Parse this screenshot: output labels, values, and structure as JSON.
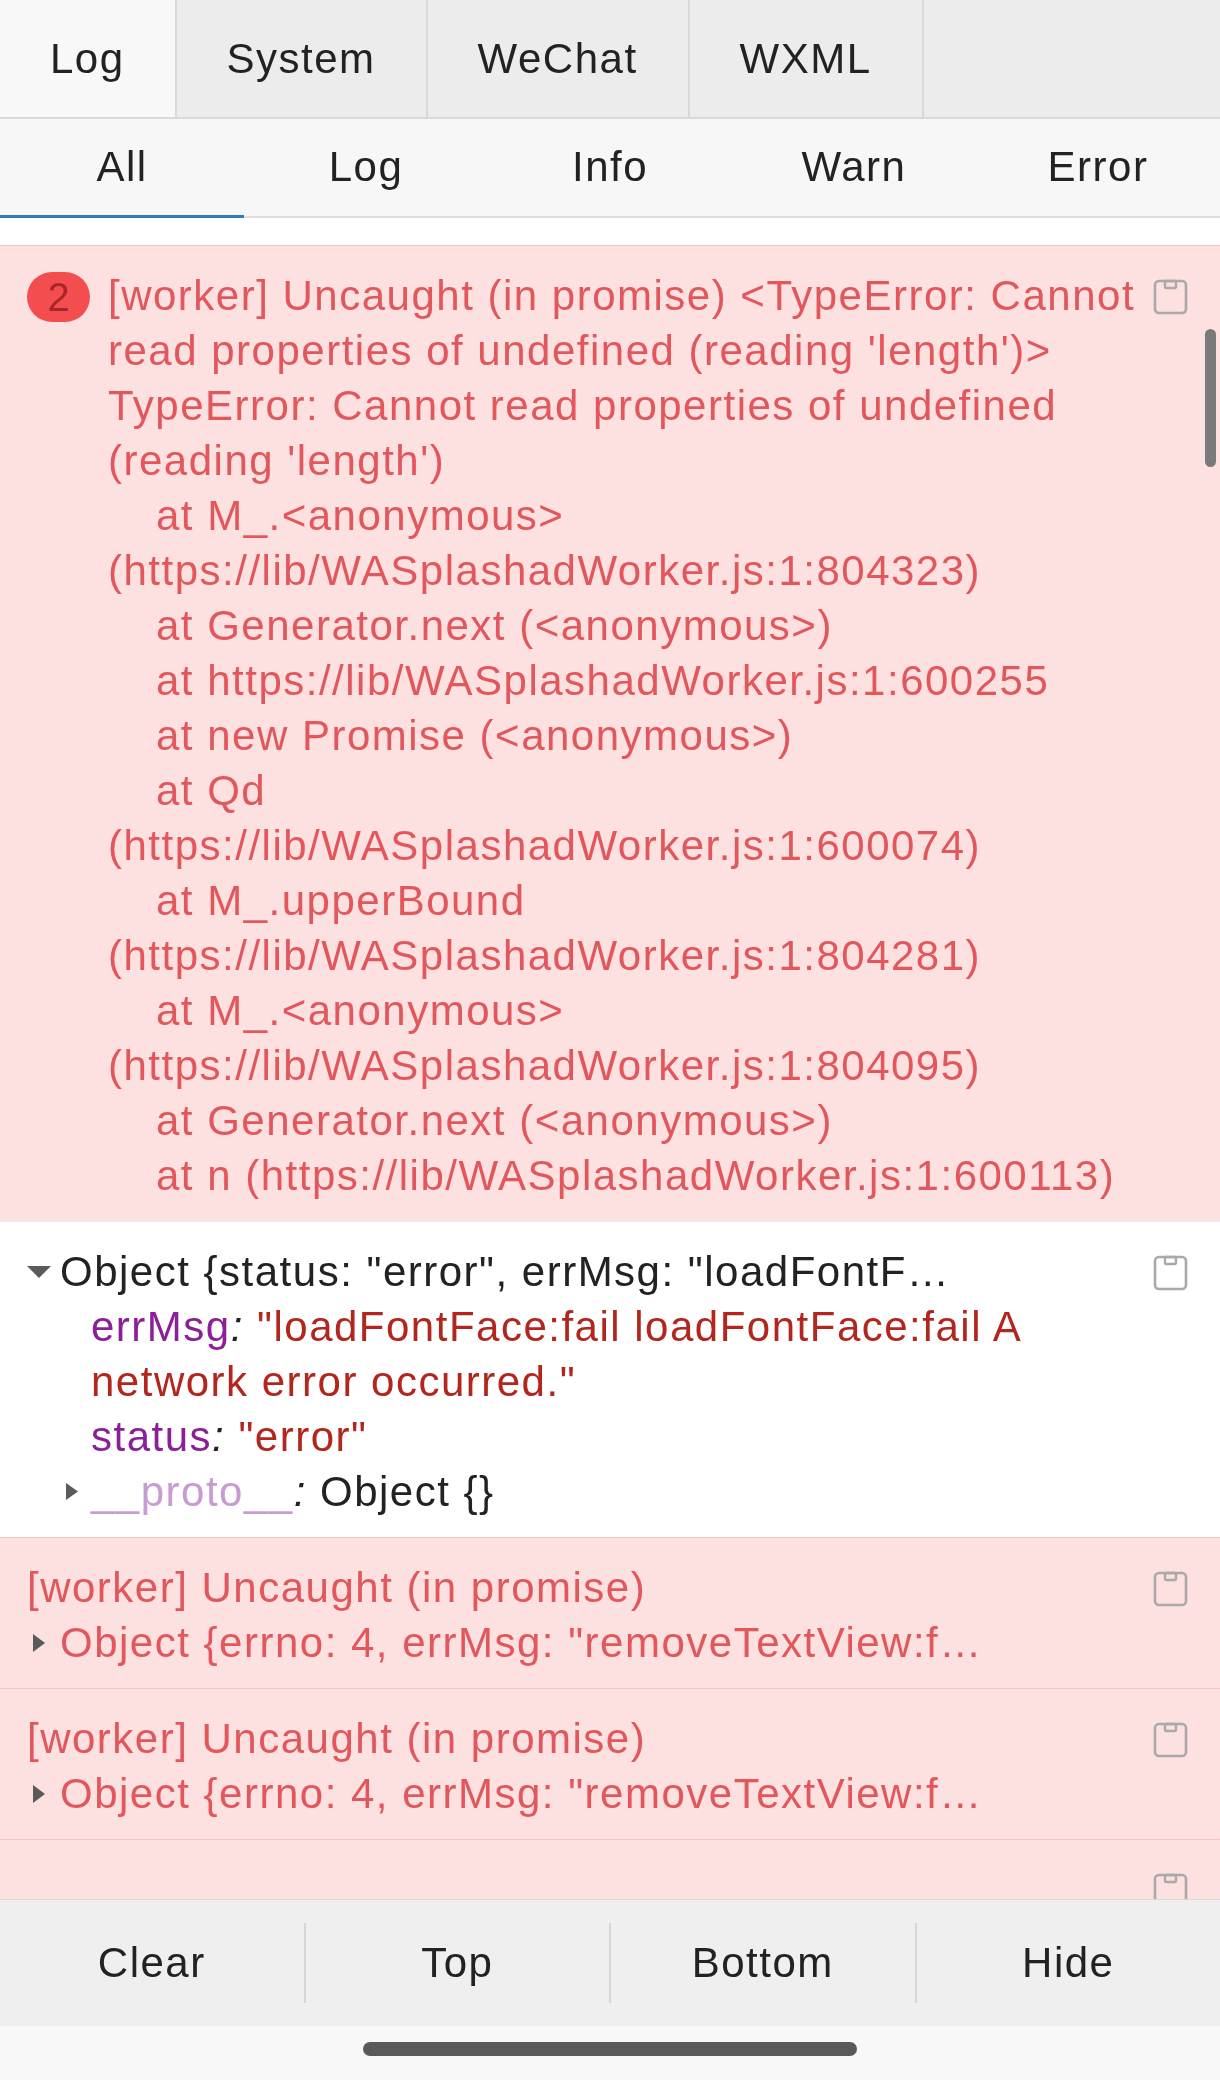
{
  "top_tabs": [
    {
      "label": "Log",
      "selected": true
    },
    {
      "label": "System",
      "selected": false
    },
    {
      "label": "WeChat",
      "selected": false
    },
    {
      "label": "WXML",
      "selected": false
    }
  ],
  "filter_tabs": [
    {
      "label": "All",
      "selected": true
    },
    {
      "label": "Log",
      "selected": false
    },
    {
      "label": "Info",
      "selected": false
    },
    {
      "label": "Warn",
      "selected": false
    },
    {
      "label": "Error",
      "selected": false
    }
  ],
  "entries": [
    {
      "kind": "error",
      "badge": "2",
      "message": "[worker] Uncaught (in promise) <TypeError: Cannot read properties of undefined (reading 'length')>",
      "error": "TypeError: Cannot read properties of undefined (reading 'length')",
      "frames": [
        "at M_.<anonymous> (https://lib/WASplashadWorker.js:1:804323)",
        "at Generator.next (<anonymous>)",
        "at https://lib/WASplashadWorker.js:1:600255",
        "at new Promise (<anonymous>)",
        "at Qd (https://lib/WASplashadWorker.js:1:600074)",
        "at M_.upperBound (https://lib/WASplashadWorker.js:1:804281)",
        "at M_.<anonymous> (https://lib/WASplashadWorker.js:1:804095)",
        "at Generator.next (<anonymous>)",
        "at n (https://lib/WASplashadWorker.js:1:600113)"
      ]
    },
    {
      "kind": "log",
      "object": {
        "summary": "Object {status: \"error\", errMsg: \"loadFontF…",
        "expanded": true,
        "properties": [
          {
            "kind": "string",
            "key": "errMsg",
            "separator": ": ",
            "value": "\"loadFontFace:fail loadFontFace:fail A network error occurred.\""
          },
          {
            "kind": "string",
            "key": "status",
            "separator": ": ",
            "value": "\"error\""
          },
          {
            "kind": "proto",
            "key": "__proto__",
            "separator": ": ",
            "value": "Object {}",
            "expanded": false
          }
        ]
      }
    },
    {
      "kind": "error",
      "message": "[worker] Uncaught (in promise)",
      "object": {
        "summary": "Object {errno: 4, errMsg: \"removeTextView:f…",
        "expanded": false
      }
    },
    {
      "kind": "error",
      "message": "[worker] Uncaught (in promise)",
      "object": {
        "summary": "Object {errno: 4, errMsg: \"removeTextView:f…",
        "expanded": false
      }
    },
    {
      "kind": "error"
    }
  ],
  "toolbar": [
    "Clear",
    "Top",
    "Bottom",
    "Hide"
  ]
}
